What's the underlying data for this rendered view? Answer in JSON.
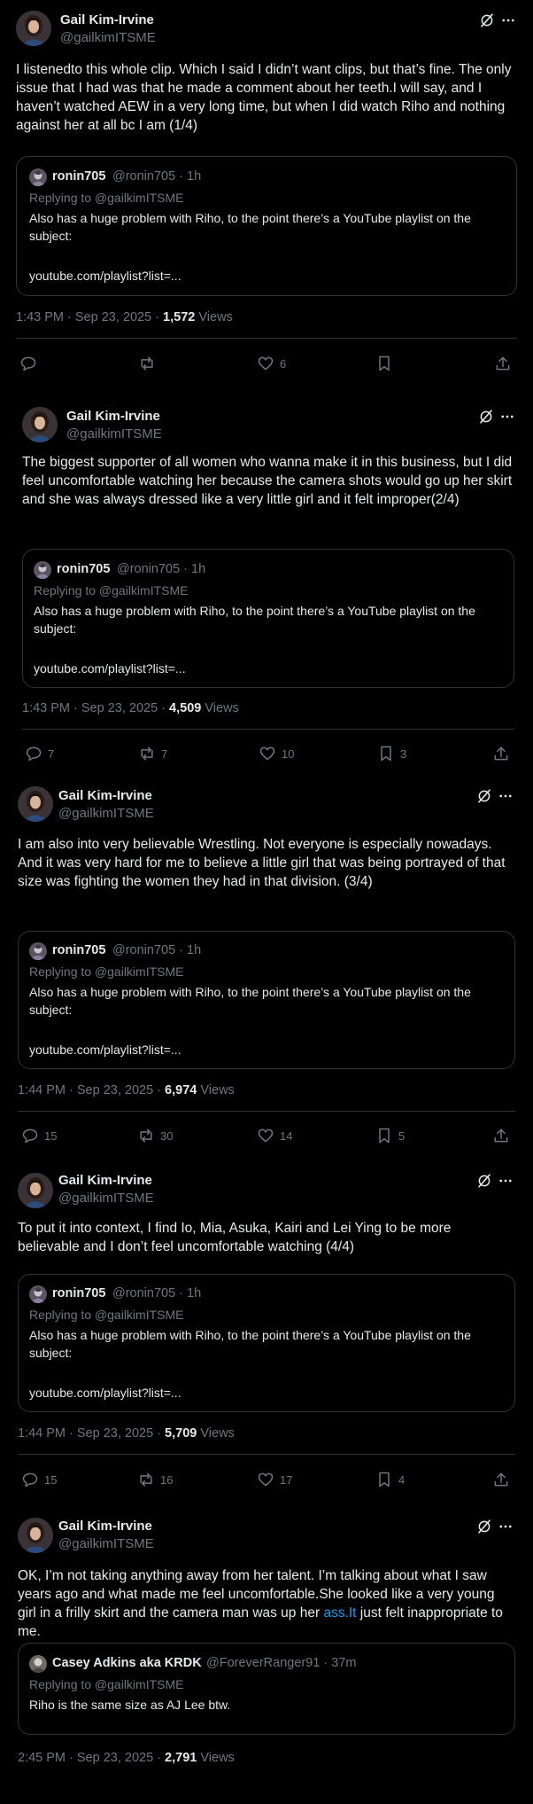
{
  "tweets": [
    {
      "author": "Gail Kim-Irvine",
      "handle": "@gailkimITSME",
      "text": "I listenedto this whole clip. Which I said I didn’t want clips, but that’s fine. The only issue that I had was that he made a comment about her teeth.I will say, and I haven’t watched AEW in a very long time, but when I did watch Riho and nothing against her at all bc I am (1/4)",
      "quote": {
        "author": "ronin705",
        "meta": "@ronin705 · 1h",
        "replying": "Replying to @gailkimITSME",
        "text": "Also has a huge problem with Riho, to the point there’s a YouTube playlist on the subject:",
        "link": "youtube.com/playlist?list=..."
      },
      "time": "1:43 PM · Sep 23, 2025 · ",
      "views_count": "1,572",
      "views_label": " Views",
      "replies": "",
      "reposts": "",
      "likes": "6"
    },
    {
      "author": "Gail Kim-Irvine",
      "handle": "@gailkimITSME",
      "text": "The biggest supporter of all women who wanna make it in this business, but I did feel uncomfortable watching her because the camera shots would go up her skirt and she was always dressed like a very little girl and it felt improper(2/4)",
      "quote": {
        "author": "ronin705",
        "meta": "@ronin705 · 1h",
        "replying": "Replying to @gailkimITSME",
        "text": "Also has a huge problem with Riho, to the point there’s a YouTube playlist on the subject:",
        "link": "youtube.com/playlist?list=..."
      },
      "time": "1:43 PM · Sep 23, 2025 · ",
      "views_count": "4,509",
      "views_label": " Views",
      "replies": "7",
      "reposts": "7",
      "likes": "10",
      "bookmarks": "3"
    },
    {
      "author": "Gail Kim-Irvine",
      "handle": "@gailkimITSME",
      "text": "I am also into very believable Wrestling. Not everyone is especially nowadays. And it was very hard for me to believe a little girl that was being portrayed of that size was fighting the women they had in that division. (3/4)",
      "quote": {
        "author": "ronin705",
        "meta": "@ronin705 · 1h",
        "replying": "Replying to @gailkimITSME",
        "text": "Also has a huge problem with Riho, to the point there’s a YouTube playlist on the subject:",
        "link": "youtube.com/playlist?list=..."
      },
      "time": "1:44 PM · Sep 23, 2025 · ",
      "views_count": "6,974",
      "views_label": " Views",
      "replies": "15",
      "reposts": "30",
      "likes": "14",
      "bookmarks": "5"
    },
    {
      "author": "Gail Kim-Irvine",
      "handle": "@gailkimITSME",
      "text": "To put it into context, I find Io, Mia, Asuka, Kairi and Lei Ying to be more believable and I don’t feel uncomfortable watching  (4/4)",
      "quote": {
        "author": "ronin705",
        "meta": "@ronin705 · 1h",
        "replying": "Replying to @gailkimITSME",
        "text": "Also has a huge problem with Riho, to the point there’s a YouTube playlist on the subject:",
        "link": "youtube.com/playlist?list=..."
      },
      "time": "1:44 PM · Sep 23, 2025 · ",
      "views_count": "5,709",
      "views_label": " Views",
      "replies": "15",
      "reposts": "16",
      "likes": "17",
      "bookmarks": "4"
    },
    {
      "author": "Gail Kim-Irvine",
      "handle": "@gailkimITSME",
      "text_part1": "OK, I’m not taking anything away from her talent. I’m talking about what I saw years ago and what made me feel uncomfortable.She looked like a very young girl in a frilly skirt and the camera man was up her ",
      "text_link": "ass.It",
      "text_part2": " just felt inappropriate to me.",
      "quote": {
        "author": "Casey Adkins aka KRDK",
        "meta": "@ForeverRanger91 · 37m",
        "replying": "Replying to @gailkimITSME",
        "text": "Riho is the same size as AJ Lee btw."
      },
      "time": "2:45 PM · Sep 23, 2025 · ",
      "views_count": "2,791",
      "views_label": " Views"
    }
  ]
}
